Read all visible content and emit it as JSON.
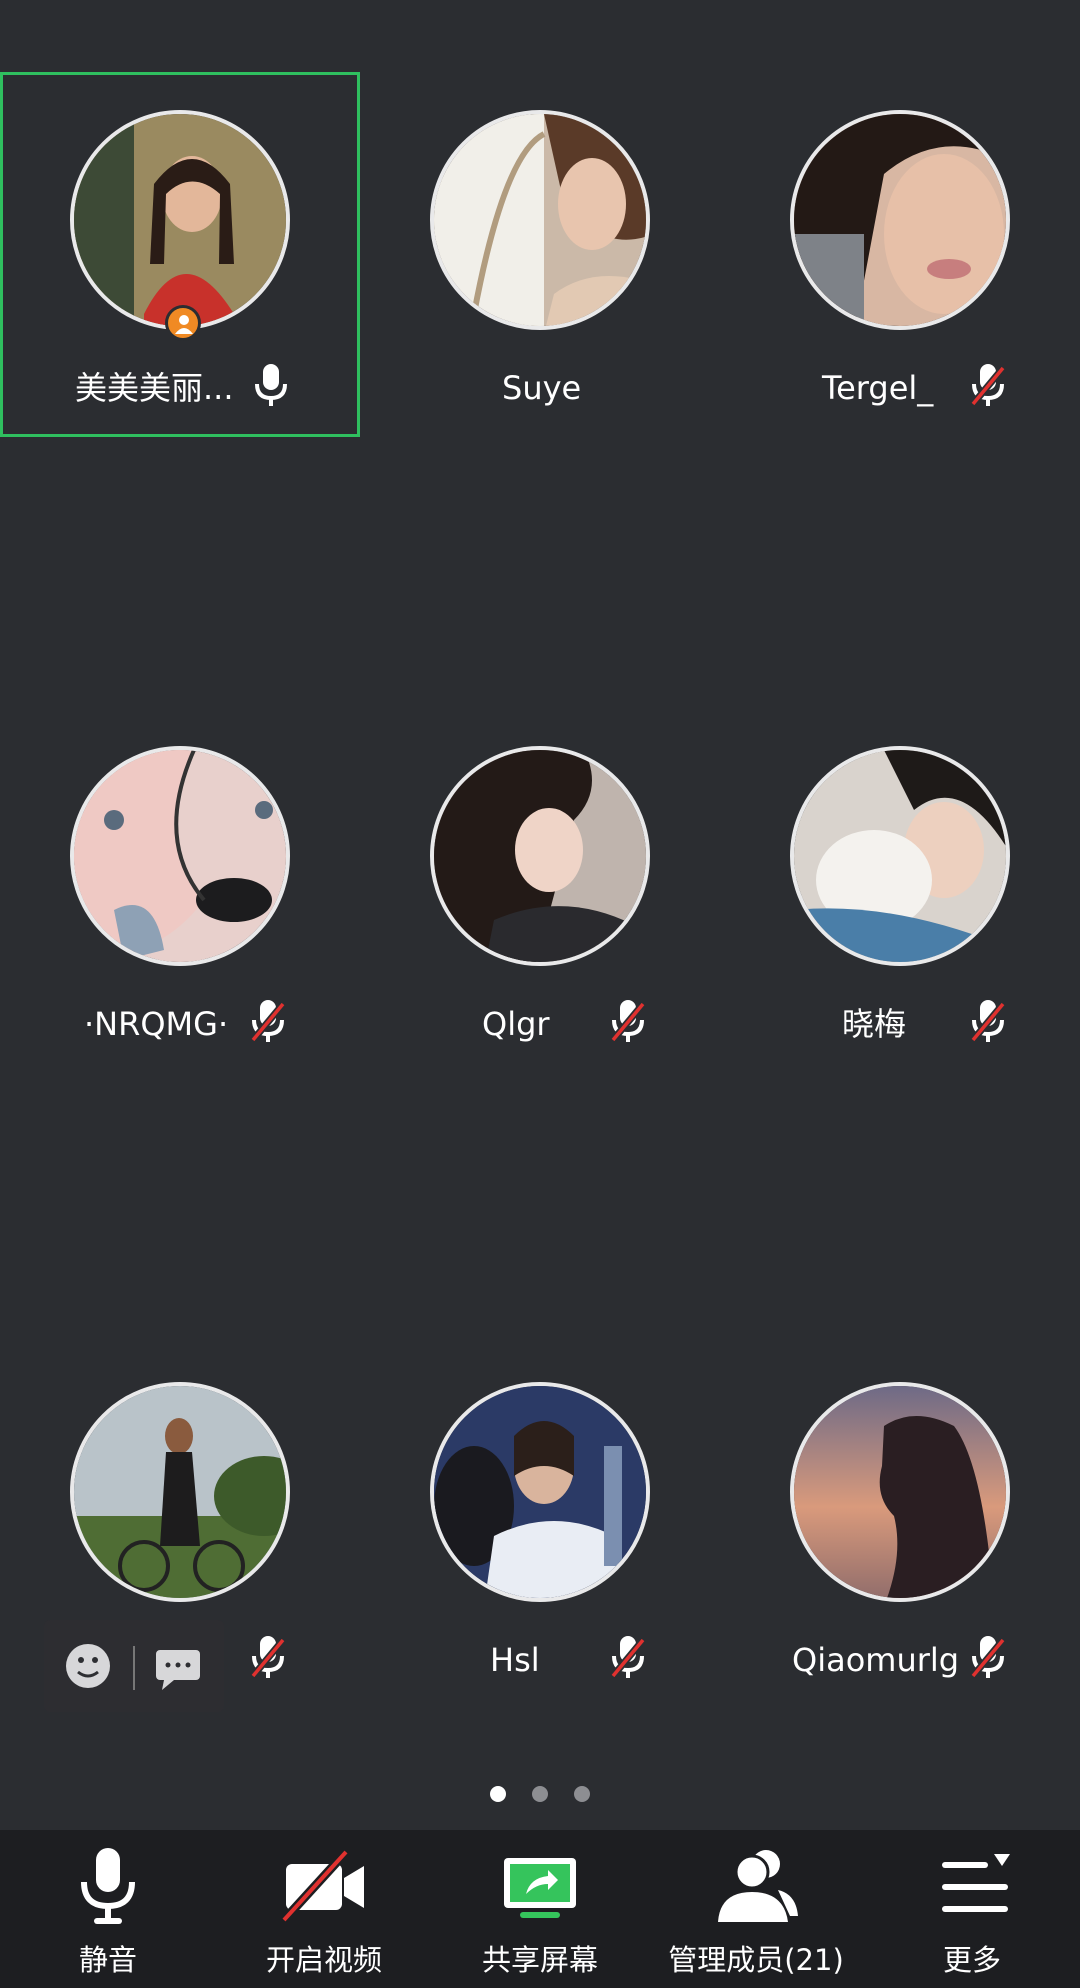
{
  "participants": [
    {
      "name": "美美美丽...",
      "mic": "on",
      "host": true,
      "active": true
    },
    {
      "name": "Suye",
      "mic": "none",
      "host": false,
      "active": false
    },
    {
      "name": "Tergel_",
      "mic": "muted",
      "host": false,
      "active": false
    },
    {
      "name": "·NRQMG·",
      "mic": "muted",
      "host": false,
      "active": false
    },
    {
      "name": "Qlgr",
      "mic": "muted",
      "host": false,
      "active": false
    },
    {
      "name": "晓梅",
      "mic": "muted",
      "host": false,
      "active": false
    },
    {
      "name": "",
      "mic": "muted",
      "host": false,
      "active": false
    },
    {
      "name": "Hsl",
      "mic": "muted",
      "host": false,
      "active": false
    },
    {
      "name": "Qiaomurlg",
      "mic": "muted",
      "host": false,
      "active": false
    }
  ],
  "pager": {
    "pages": 3,
    "current": 1
  },
  "toolbar": {
    "mute": "静音",
    "video": "开启视频",
    "share": "共享屏幕",
    "members": "管理成员(21)",
    "more": "更多"
  },
  "colors": {
    "background": "#2b2d31",
    "toolbar": "#1d1e21",
    "active_border": "#2fbf5f",
    "host_badge": "#f08a24",
    "muted_slash": "#e0312f",
    "share_green": "#35c45c"
  }
}
